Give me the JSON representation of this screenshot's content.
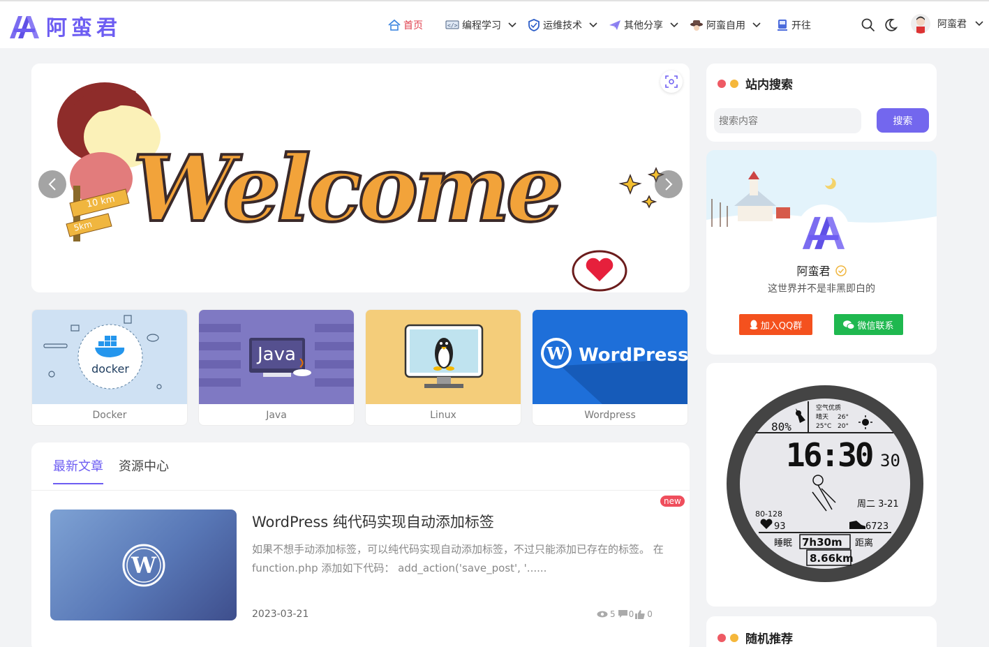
{
  "site": {
    "logo_text": "阿蛮君"
  },
  "nav": {
    "items": [
      {
        "label": "首页",
        "icon": "home-icon",
        "active": true
      },
      {
        "label": "编程学习",
        "icon": "code-icon",
        "dropdown": true
      },
      {
        "label": "运维技术",
        "icon": "shield-icon",
        "dropdown": true
      },
      {
        "label": "其他分享",
        "icon": "paper-plane-icon",
        "dropdown": true
      },
      {
        "label": "阿蛮自用",
        "icon": "hat-icon",
        "dropdown": true
      },
      {
        "label": "开往",
        "icon": "train-icon"
      }
    ],
    "user": {
      "name": "阿蛮君"
    }
  },
  "banner": {
    "text": "Welcome",
    "sign_1": "10 km",
    "sign_2": "5km"
  },
  "categories": [
    {
      "label": "Docker",
      "thumb_text": "docker",
      "color": "#cfe1f3"
    },
    {
      "label": "Java",
      "thumb_text": "Java",
      "color": "#7f79c3"
    },
    {
      "label": "Linux",
      "thumb_text": "",
      "color": "#f4cd7a"
    },
    {
      "label": "Wordpress",
      "thumb_text": "WordPress",
      "color": "#1e6fd9"
    }
  ],
  "articles": {
    "tabs": [
      {
        "label": "最新文章",
        "active": true
      },
      {
        "label": "资源中心",
        "active": false
      }
    ],
    "posts": [
      {
        "badge": "new",
        "title": "WordPress 纯代码实现自动添加标签",
        "excerpt": "如果不想手动添加标签，可以纯代码实现自动添加标签，不过只能添加已存在的标签。 在 function.php 添加如下代码： add_action('save_post', '......",
        "date": "2023-03-21",
        "views": "5",
        "comments": "0",
        "likes": "0"
      }
    ]
  },
  "sidebar": {
    "search": {
      "title": "站内搜索",
      "placeholder": "搜索内容",
      "button": "搜索"
    },
    "profile": {
      "name": "阿蛮君",
      "desc": "这世界并不是非黑即白的",
      "qq_button": "加入QQ群",
      "wechat_button": "微信联系"
    },
    "clock": {
      "air_label": "空气优质",
      "weather_1": "晴天",
      "temp_high": "26°",
      "temp_low_label": "25°C",
      "temp_low": "20°",
      "battery": "80%",
      "time": "16:30",
      "seconds": "30",
      "date": "周二 3-21",
      "bp": "80-128",
      "heart_rate": "93",
      "steps": "6723",
      "sleep_label": "睡眠",
      "sleep": "7h30m",
      "distance_label": "距离",
      "distance": "8.66km"
    },
    "random": {
      "title": "随机推荐"
    }
  },
  "colors": {
    "accent": "#6d5df2",
    "nav_active": "#e0424f",
    "qq": "#f4511e",
    "wechat": "#1fb84f"
  }
}
